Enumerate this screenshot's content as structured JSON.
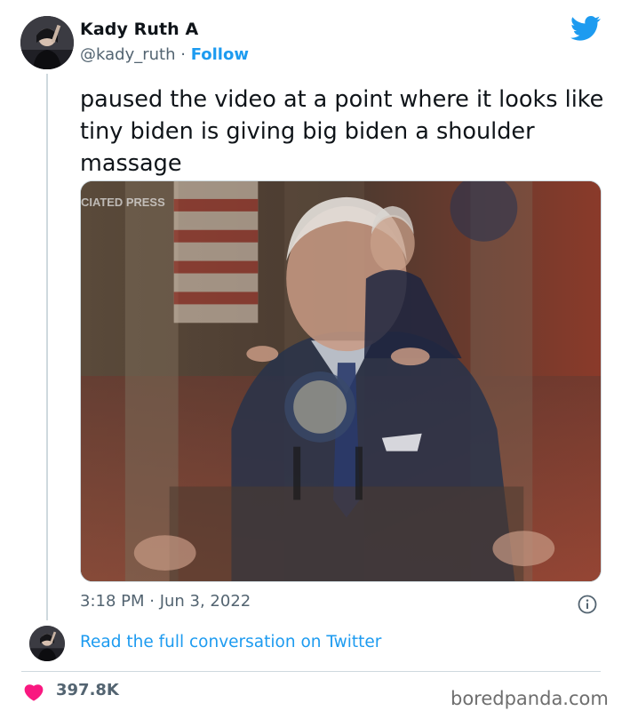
{
  "tweet": {
    "author_name": "Kady Ruth A",
    "author_handle": "@kady_ruth",
    "separator": "·",
    "follow_label": "Follow",
    "text": "paused the video at a point where it looks like tiny biden is giving big biden a shoulder massage",
    "media": {
      "overlay_text": "CIATED PRESS"
    },
    "timestamp": "3:18 PM · Jun 3, 2022",
    "read_more_label": "Read the full conversation on Twitter",
    "like_count": "397.8K"
  },
  "watermark": "boredpanda.com",
  "icons": {
    "brand": "twitter-bird-icon",
    "info": "info-icon",
    "like": "heart-icon"
  },
  "colors": {
    "link": "#1d9bf0",
    "secondary_text": "#536471",
    "heart": "#f91880",
    "divider": "#cfd9de"
  }
}
